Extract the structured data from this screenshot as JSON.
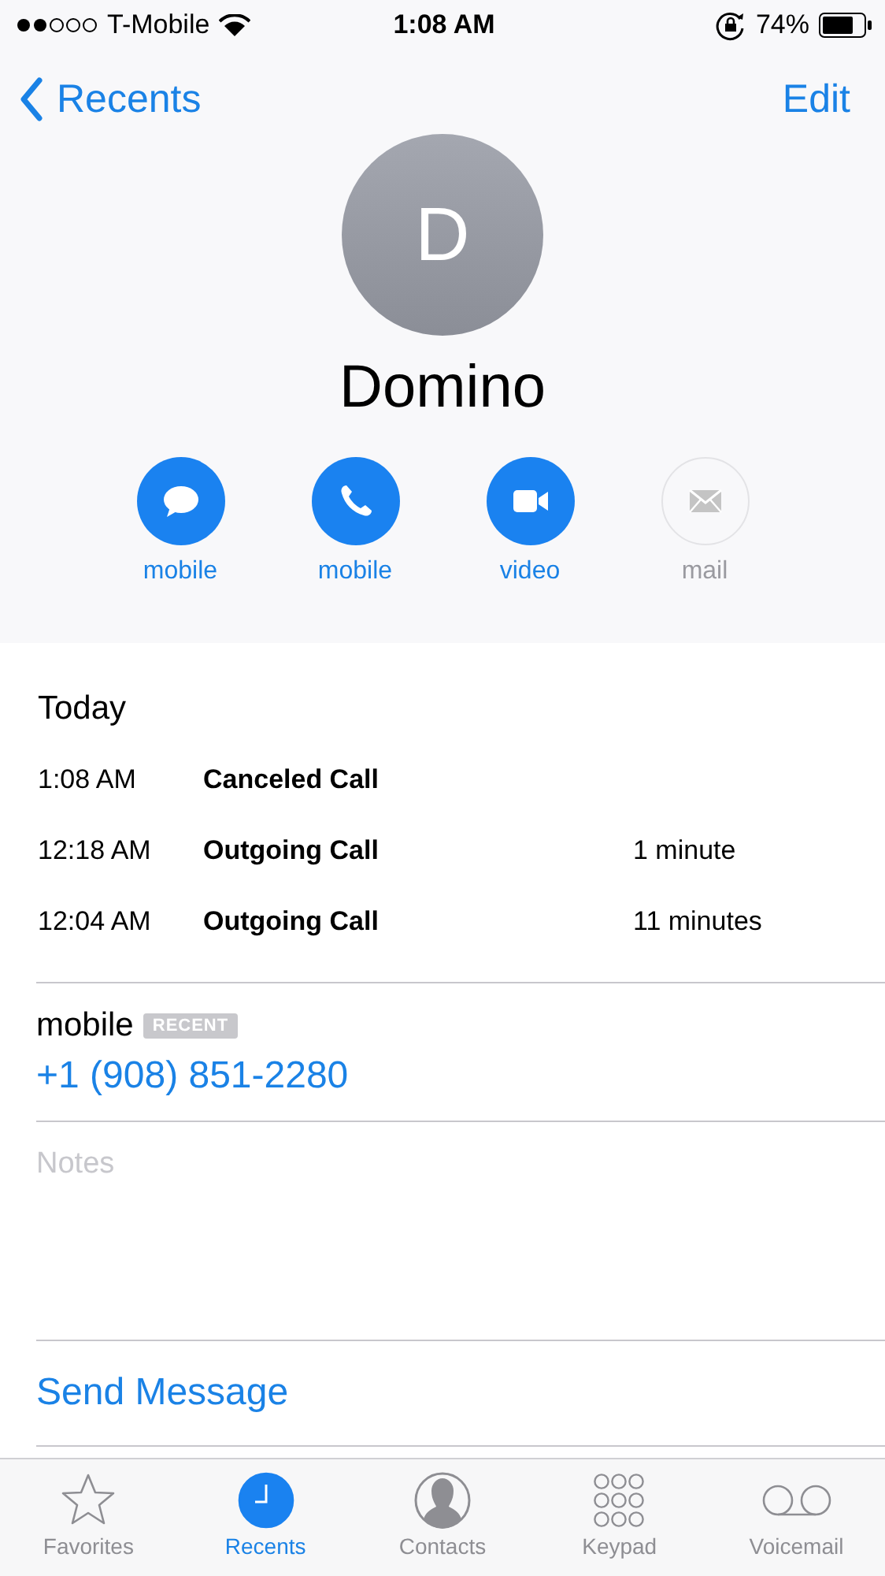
{
  "status_bar": {
    "carrier": "T-Mobile",
    "time": "1:08 AM",
    "battery": "74%"
  },
  "nav": {
    "back": "Recents",
    "action": "Edit"
  },
  "contact": {
    "initial": "D",
    "name": "Domino"
  },
  "actions": [
    {
      "kind": "message",
      "label": "mobile",
      "disabled": false
    },
    {
      "kind": "call",
      "label": "mobile",
      "disabled": false
    },
    {
      "kind": "video",
      "label": "video",
      "disabled": false
    },
    {
      "kind": "mail",
      "label": "mail",
      "disabled": true
    }
  ],
  "history": {
    "heading": "Today",
    "calls": [
      {
        "time": "1:08 AM",
        "type": "Canceled Call"
      },
      {
        "time": "12:18 AM",
        "type": "Outgoing Call",
        "duration": "1 minute"
      },
      {
        "time": "12:04 AM",
        "type": "Outgoing Call",
        "duration": "11 minutes"
      }
    ]
  },
  "phone": {
    "label": "mobile",
    "badge": "RECENT",
    "number": "+1 (908) 851-2280"
  },
  "notes": {
    "placeholder": "Notes"
  },
  "send_message": "Send Message",
  "tabs": [
    {
      "kind": "favorites",
      "label": "Favorites",
      "selected": false
    },
    {
      "kind": "recents",
      "label": "Recents",
      "selected": true
    },
    {
      "kind": "contacts",
      "label": "Contacts",
      "selected": false
    },
    {
      "kind": "keypad",
      "label": "Keypad",
      "selected": false
    },
    {
      "kind": "voicemail",
      "label": "Voicemail",
      "selected": false
    }
  ]
}
